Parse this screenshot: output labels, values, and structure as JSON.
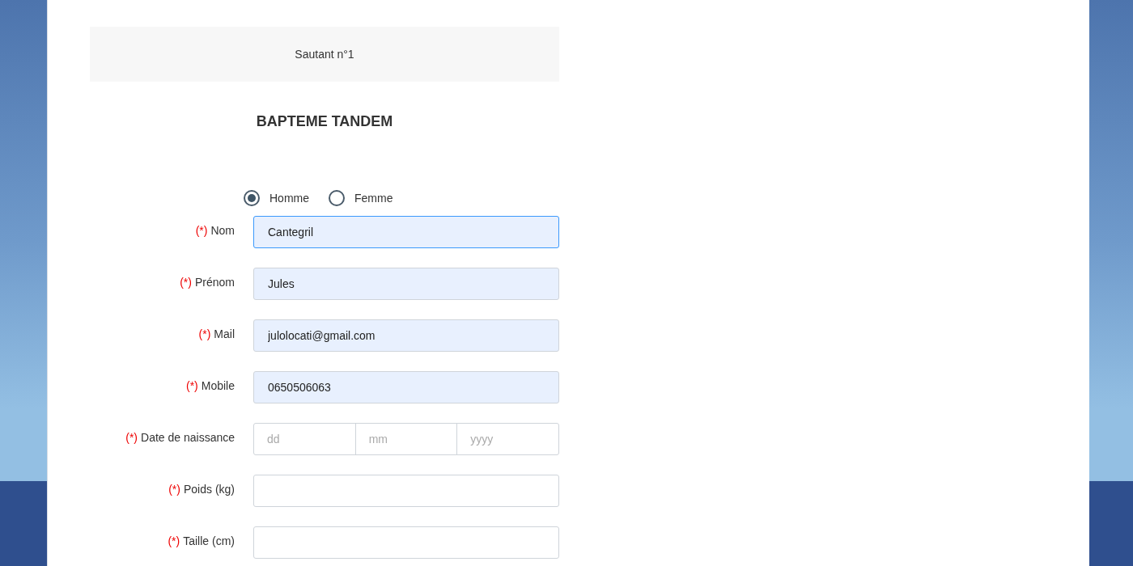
{
  "header": {
    "title": "Sautant n°1"
  },
  "section_title": "BAPTEME TANDEM",
  "gender": [
    {
      "label": "Homme",
      "selected": true
    },
    {
      "label": "Femme",
      "selected": false
    }
  ],
  "fields": [
    {
      "kind": "text",
      "mark": "(*)",
      "label": "Nom",
      "value": "Cantegril",
      "focused": true
    },
    {
      "kind": "text",
      "mark": "(*)",
      "label": "Prénom",
      "value": "Jules",
      "focused": false
    },
    {
      "kind": "text",
      "mark": "(*)",
      "label": "Mail",
      "value": "julolocati@gmail.com",
      "focused": false
    },
    {
      "kind": "text",
      "mark": "(*)",
      "label": "Mobile",
      "value": "0650506063",
      "focused": false
    },
    {
      "kind": "date",
      "mark": "(*)",
      "label": "Date de naissance",
      "parts": [
        {
          "placeholder": "dd"
        },
        {
          "placeholder": "mm"
        },
        {
          "placeholder": "yyyy"
        }
      ]
    },
    {
      "kind": "text",
      "mark": "(*)",
      "label": "Poids (kg)",
      "focused": false
    },
    {
      "kind": "text",
      "mark": "(*)",
      "label": "Taille (cm)",
      "focused": false
    }
  ]
}
